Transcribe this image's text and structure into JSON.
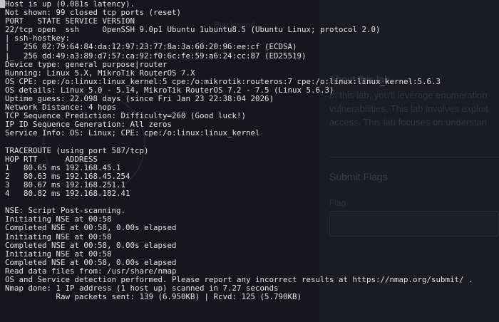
{
  "background_page": {
    "top_title": "Blackwood",
    "about_heading": "About this lab",
    "about_lines": [
      "In this lab, you'll leverage enumeration",
      "vulnerabilities. This lab involves exploit",
      "access. This lab focuses on understan"
    ],
    "submit_heading": "Submit Flags",
    "flag_label": "Flag"
  },
  "terminal": {
    "lines": [
      "Host is up (0.081s latency).",
      "Not shown: 99 closed tcp ports (reset)",
      "PORT   STATE SERVICE VERSION",
      "22/tcp open  ssh     OpenSSH 9.0p1 Ubuntu 1ubuntu8.5 (Ubuntu Linux; protocol 2.0)",
      "| ssh-hostkey:",
      "|   256 02:79:64:84:da:12:97:23:77:8a:3a:60:20:96:ee:cf (ECDSA)",
      "|_  256 dd:49:a3:89:d7:57:ca:92:f0:6c:fe:59:a6:24:cc:87 (ED25519)",
      "Device type: general purpose|router",
      "Running: Linux 5.X, MikroTik RouterOS 7.X",
      "OS CPE: cpe:/o:linux:linux_kernel:5 cpe:/o:mikrotik:routeros:7 cpe:/o:linux:linux_kernel:5.6.3",
      "OS details: Linux 5.0 - 5.14, MikroTik RouterOS 7.2 - 7.5 (Linux 5.6.3)",
      "Uptime guess: 22.098 days (since Fri Jan 23 22:38:04 2026)",
      "Network Distance: 4 hops",
      "TCP Sequence Prediction: Difficulty=260 (Good luck!)",
      "IP ID Sequence Generation: All zeros",
      "Service Info: OS: Linux; CPE: cpe:/o:linux:linux_kernel",
      "",
      "TRACEROUTE (using port 587/tcp)",
      "HOP RTT      ADDRESS",
      "1   80.65 ms 192.168.45.1",
      "2   80.63 ms 192.168.45.254",
      "3   80.67 ms 192.168.251.1",
      "4   80.82 ms 192.168.182.41",
      "",
      "NSE: Script Post-scanning.",
      "Initiating NSE at 00:58",
      "Completed NSE at 00:58, 0.00s elapsed",
      "Initiating NSE at 00:58",
      "Completed NSE at 00:58, 0.00s elapsed",
      "Initiating NSE at 00:58",
      "Completed NSE at 00:58, 0.00s elapsed",
      "Read data files from: /usr/share/nmap",
      "OS and Service detection performed. Please report any incorrect results at https://nmap.org/submit/ .",
      "Nmap done: 1 IP address (1 host up) scanned in 7.27 seconds",
      "           Raw packets sent: 139 (6.950KB) | Rcvd: 125 (5.790KB)"
    ]
  },
  "colors": {
    "terminal_text": "#e4e4e4",
    "background": "#16161c"
  }
}
